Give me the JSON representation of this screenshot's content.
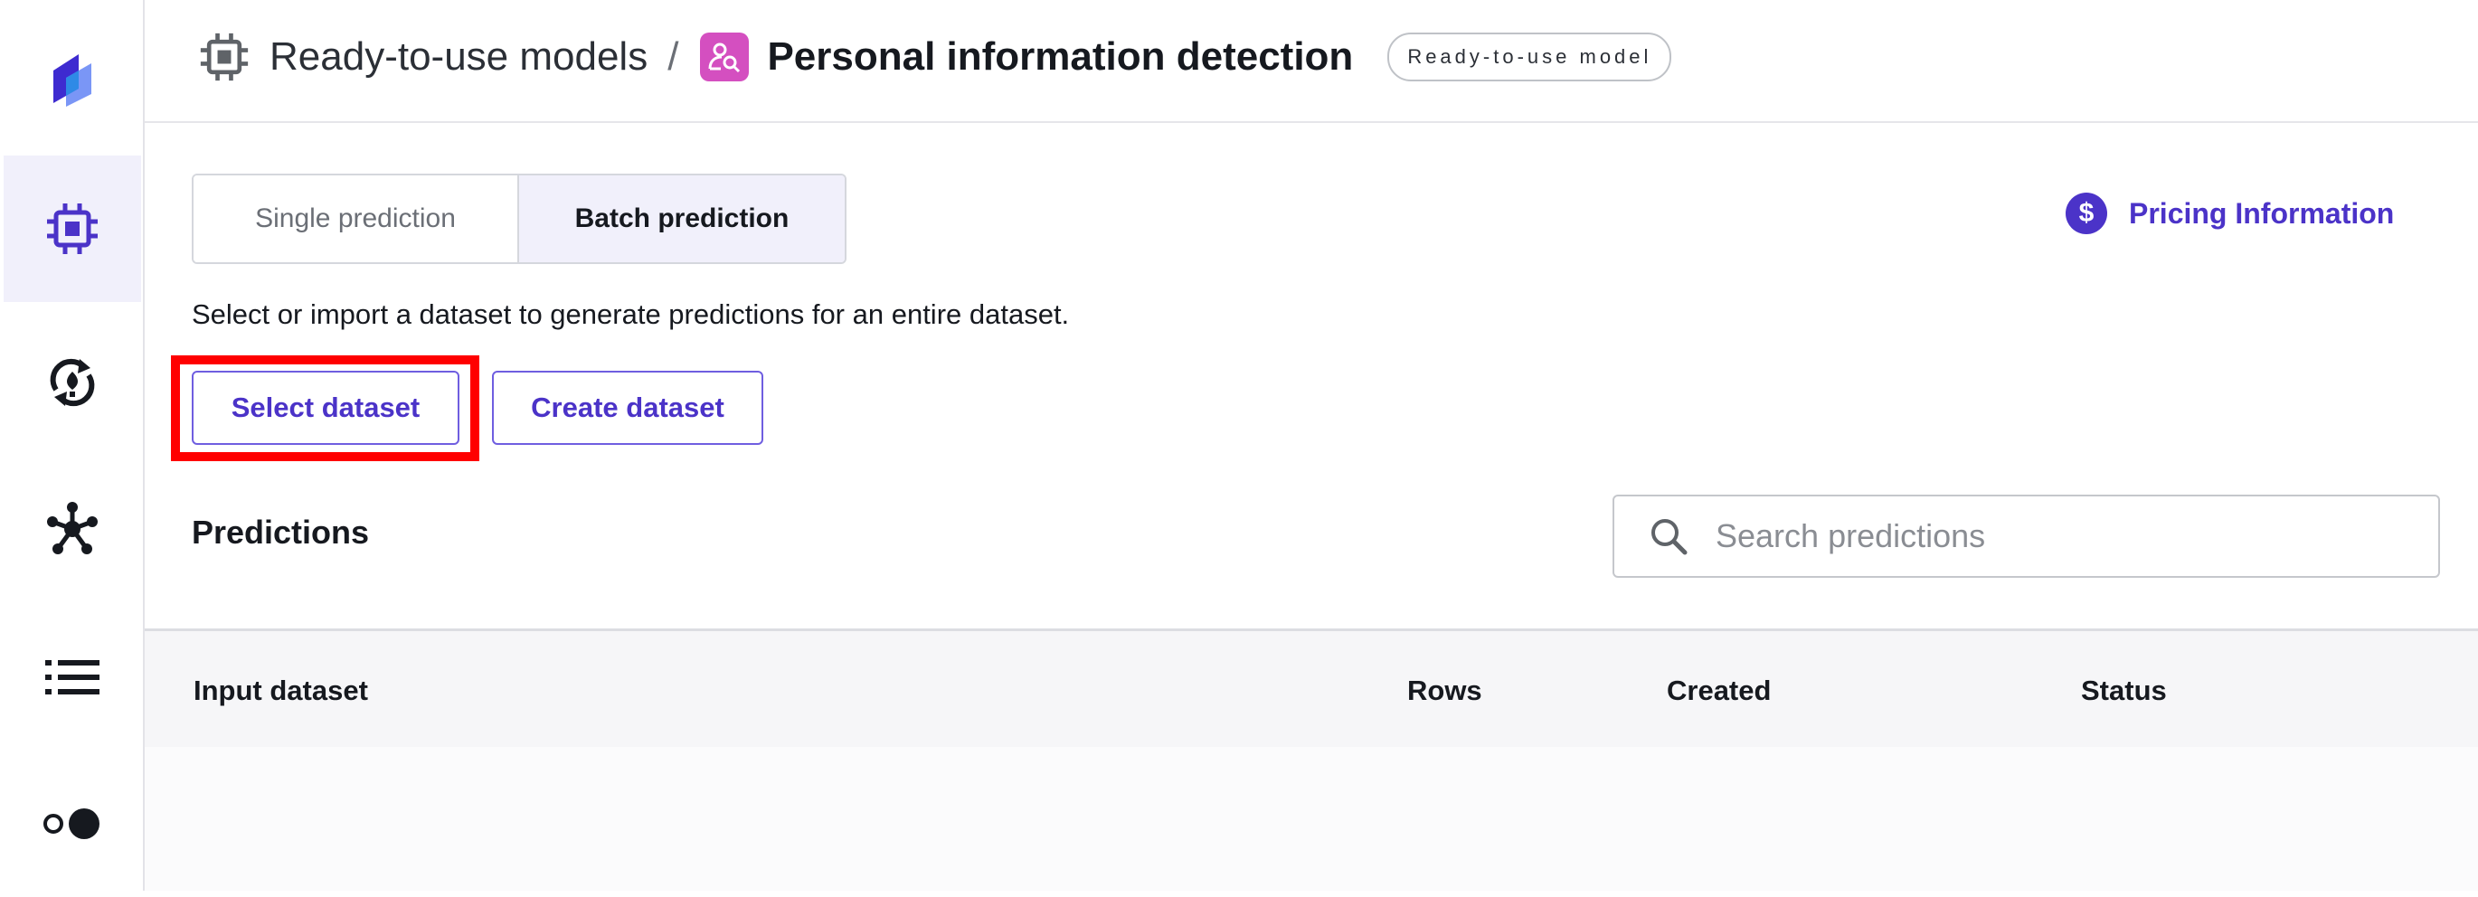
{
  "breadcrumb": {
    "parent": "Ready-to-use models",
    "separator": "/",
    "current": "Personal information detection",
    "badge": "Ready-to-use model"
  },
  "sidebar": {
    "items": [
      {
        "icon": "canvas-logo-icon",
        "active": false
      },
      {
        "icon": "chip-icon",
        "active": true
      },
      {
        "icon": "refresh-bulb-icon",
        "active": false
      },
      {
        "icon": "network-nodes-icon",
        "active": false
      },
      {
        "icon": "list-icon",
        "active": false
      },
      {
        "icon": "toggle-dots-icon",
        "active": false
      }
    ]
  },
  "tabs": {
    "single": "Single prediction",
    "batch": "Batch prediction",
    "active": "batch"
  },
  "pricing": {
    "label": "Pricing Information",
    "icon": "dollar-icon"
  },
  "description": "Select or import a dataset to generate predictions for an entire dataset.",
  "actions": {
    "select_dataset": "Select dataset",
    "create_dataset": "Create dataset"
  },
  "predictions": {
    "title": "Predictions",
    "search_placeholder": "Search predictions",
    "columns": [
      "Input dataset",
      "Rows",
      "Created",
      "Status"
    ]
  },
  "colors": {
    "accent": "#4b33c8",
    "highlight": "#ff0000",
    "pii_icon_bg": "#d44fc0"
  }
}
